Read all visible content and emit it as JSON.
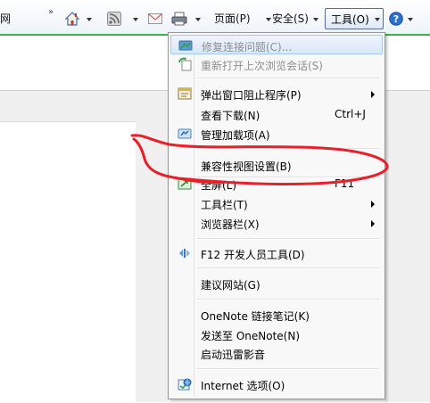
{
  "toolbar": {
    "left_text": "网",
    "chevron": "»",
    "page_label": "页面(P)",
    "safety_label": "安全(S)",
    "tools_label": "工具(O)",
    "icons": [
      "home-icon",
      "rss-icon",
      "mail-icon",
      "print-icon",
      "help-icon"
    ]
  },
  "menu": {
    "items": [
      {
        "label": "修复连接问题(C)...",
        "disabled": true,
        "icon": "repair-connection-icon"
      },
      {
        "label": "重新打开上次浏览会话(S)",
        "disabled": true,
        "icon": "reopen-session-icon"
      },
      {
        "label": "弹出窗口阻止程序(P)",
        "submenu": true,
        "icon": "popup-blocker-icon"
      },
      {
        "label": "查看下载(N)",
        "shortcut": "Ctrl+J"
      },
      {
        "label": "管理加载项(A)",
        "icon": "addons-icon"
      },
      {
        "label": "兼容性视图设置(B)"
      },
      {
        "label": "全屏(L)",
        "shortcut": "F11",
        "icon": "fullscreen-icon"
      },
      {
        "label": "工具栏(T)",
        "submenu": true
      },
      {
        "label": "浏览器栏(X)",
        "submenu": true
      },
      {
        "label": "F12 开发人员工具(D)",
        "icon": "dev-tools-icon"
      },
      {
        "label": "建议网站(G)"
      },
      {
        "label": "OneNote 链接笔记(K)"
      },
      {
        "label": "发送至 OneNote(N)"
      },
      {
        "label": "启动迅雷影音"
      },
      {
        "label": "Internet 选项(O)",
        "icon": "internet-options-icon"
      }
    ]
  },
  "colors": {
    "menu_bg": "#f8f8f8",
    "hover_bg": "#dbe8f8",
    "annotation_red": "#e8202a",
    "progress_green": "#35b449"
  }
}
